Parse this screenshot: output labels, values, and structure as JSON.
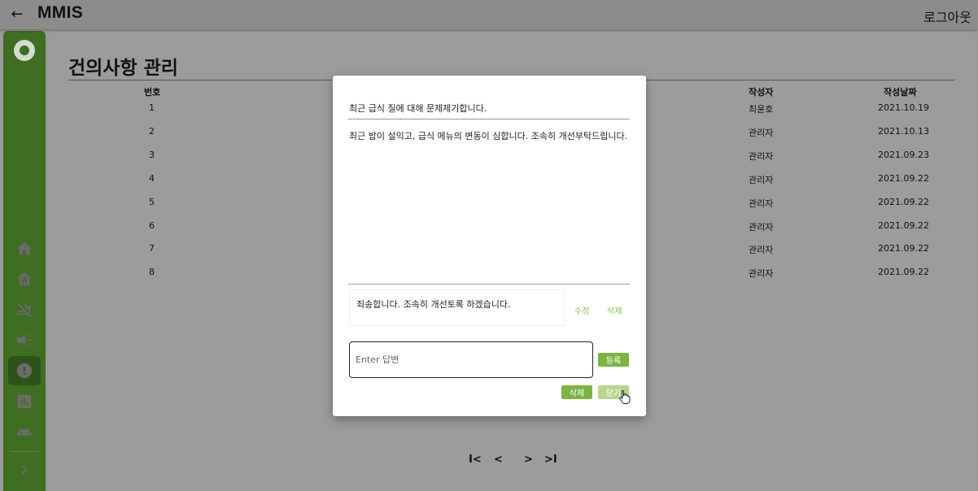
{
  "app": {
    "title": "MMIS",
    "logout_label": "로그아웃"
  },
  "sidebar": {
    "avatar_icon": "account-icon",
    "items": [
      {
        "name": "home",
        "icon": "home-icon"
      },
      {
        "name": "meal",
        "icon": "restaurant-house-icon"
      },
      {
        "name": "no-food",
        "icon": "no-food-icon"
      },
      {
        "name": "notice",
        "icon": "campaign-icon"
      },
      {
        "name": "suggestion",
        "icon": "alert-circle-icon",
        "active": true
      },
      {
        "name": "stats",
        "icon": "bar-chart-icon"
      },
      {
        "name": "android",
        "icon": "android-icon"
      }
    ],
    "expand_icon": "chevron-right-icon"
  },
  "page": {
    "title": "건의사항 관리",
    "columns": {
      "no": "번호",
      "author": "작성자",
      "date": "작성날짜"
    },
    "rows": [
      {
        "no": "1",
        "author": "최윤호",
        "date": "2021.10.19"
      },
      {
        "no": "2",
        "author": "관리자",
        "date": "2021.10.13"
      },
      {
        "no": "3",
        "author": "관리자",
        "date": "2021.09.23"
      },
      {
        "no": "4",
        "author": "관리자",
        "date": "2021.09.22"
      },
      {
        "no": "5",
        "author": "관리자",
        "date": "2021.09.22"
      },
      {
        "no": "6",
        "author": "관리자",
        "date": "2021.09.22"
      },
      {
        "no": "7",
        "author": "관리자",
        "date": "2021.09.22"
      },
      {
        "no": "8",
        "author": "관리자",
        "date": "2021.09.22"
      }
    ],
    "pagination": {
      "first": "I<",
      "prev": "<",
      "next": ">",
      "last": ">I"
    }
  },
  "modal": {
    "title": "최근 급식 질에 대해 문제제기합니다.",
    "body": "최근 밥이 설익고, 급식 메뉴의 변동이 심합니다. 조속히 개선부탁드립니다.",
    "reply": "죄송합니다. 조속히 개선토록 하겠습니다.",
    "reply_edit": "수정",
    "reply_delete": "삭제",
    "answer_placeholder": "Enter 답변",
    "register": "등록",
    "delete": "삭제",
    "close": "닫기"
  },
  "colors": {
    "accent": "#7cb342",
    "sidebar": "#3f6d22"
  }
}
